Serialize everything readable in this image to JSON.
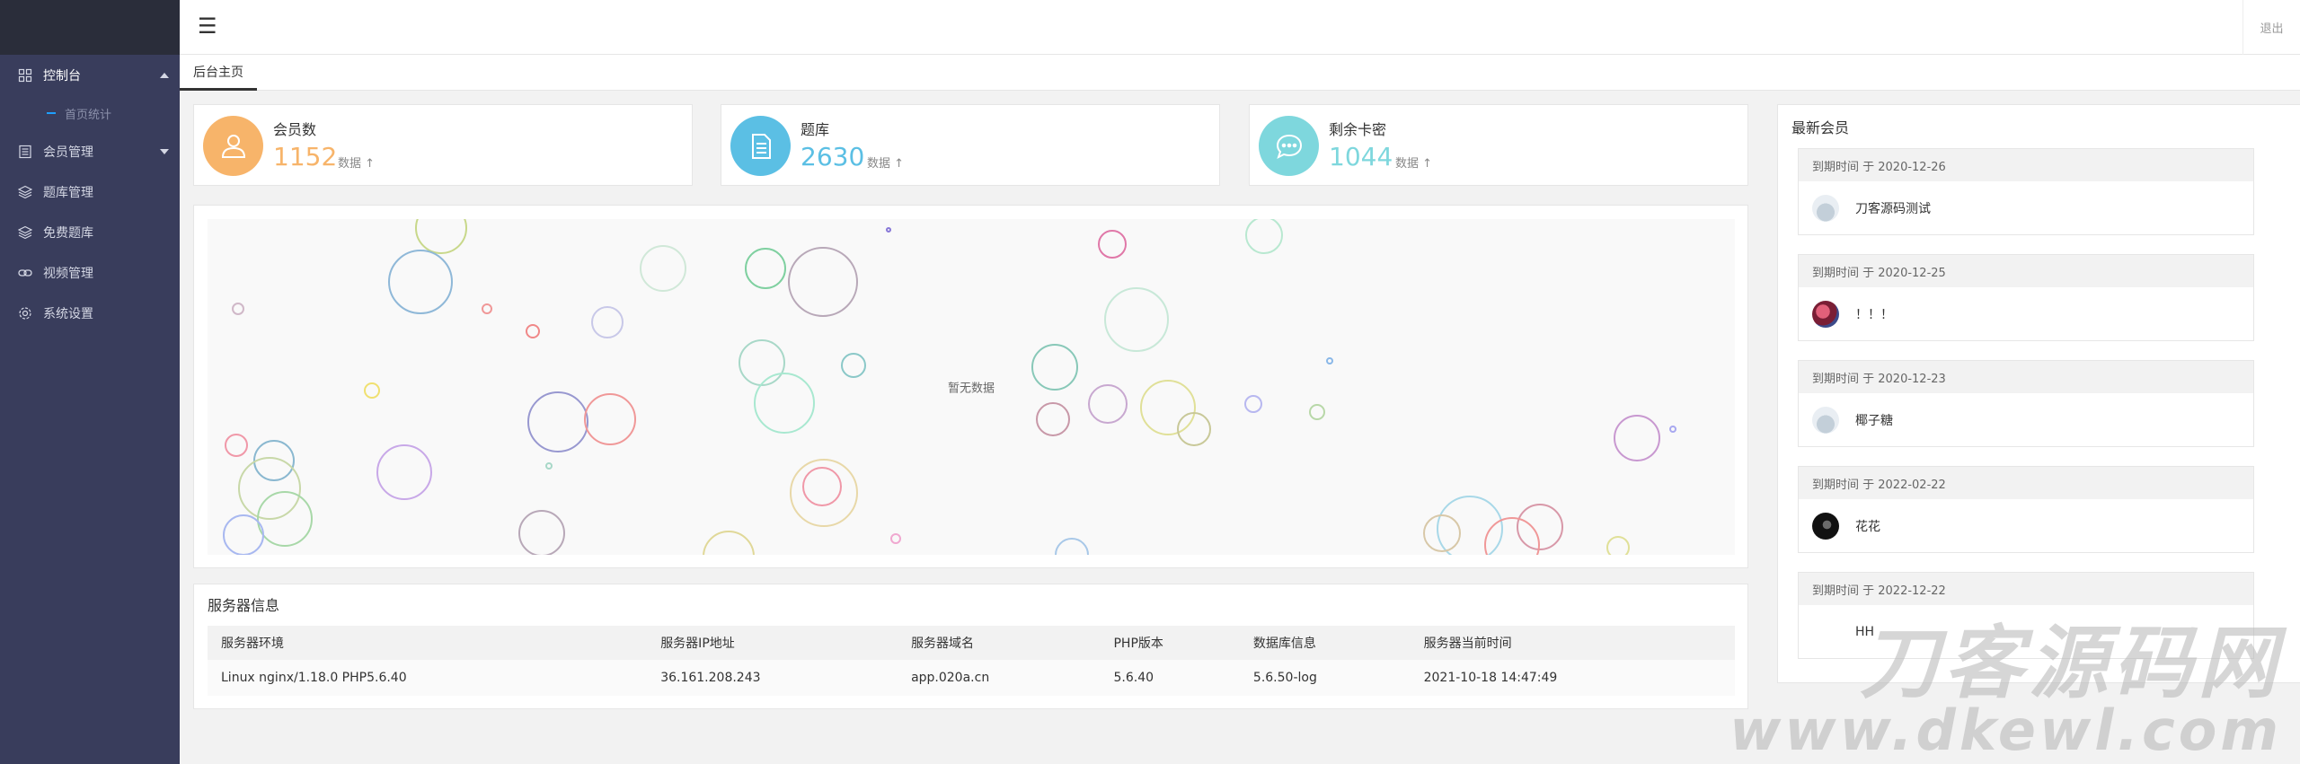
{
  "header": {
    "menu_glyph": "☰",
    "logout_label": "退出"
  },
  "sidebar": {
    "items": [
      {
        "label": "控制台",
        "icon": "grid-icon",
        "expanded": true
      },
      {
        "label": "首页统计",
        "sub": true
      },
      {
        "label": "会员管理",
        "icon": "list-icon",
        "expanded": false
      },
      {
        "label": "题库管理",
        "icon": "layers-icon"
      },
      {
        "label": "免费题库",
        "icon": "layers-icon"
      },
      {
        "label": "视频管理",
        "icon": "link-icon"
      },
      {
        "label": "系统设置",
        "icon": "gear-icon"
      }
    ]
  },
  "tabs": [
    {
      "label": "后台主页",
      "active": true
    }
  ],
  "stats": [
    {
      "label": "会员数",
      "value": "1152",
      "sub": "数据 ↑",
      "color": "#f7b46a",
      "icon": "user-icon"
    },
    {
      "label": "题库",
      "value": "2630",
      "sub": "数据 ↑",
      "color": "#5bbfe4",
      "icon": "document-icon"
    },
    {
      "label": "剩余卡密",
      "value": "1044",
      "sub": "数据 ↑",
      "color": "#7ed7dd",
      "icon": "chat-icon"
    }
  ],
  "chart": {
    "empty_text": "暂无数据"
  },
  "server": {
    "title": "服务器信息",
    "headers": [
      "服务器环境",
      "服务器IP地址",
      "服务器域名",
      "PHP版本",
      "数据库信息",
      "服务器当前时间"
    ],
    "row": [
      "Linux nginx/1.18.0 PHP5.6.40",
      "36.161.208.243",
      "app.020a.cn",
      "5.6.40",
      "5.6.50-log",
      "2021-10-18 14:47:49"
    ]
  },
  "members": {
    "title": "最新会员",
    "items": [
      {
        "date": "到期时间 于 2020-12-26",
        "name": "刀客源码测试",
        "avatar_color": "#dfe7ee"
      },
      {
        "date": "到期时间 于 2020-12-25",
        "name": "！！！",
        "avatar_color": "#b8344a"
      },
      {
        "date": "到期时间 于 2020-12-23",
        "name": "椰子糖",
        "avatar_color": "#dfe7ee"
      },
      {
        "date": "到期时间 于 2022-02-22",
        "name": "花花",
        "avatar_color": "#222222"
      },
      {
        "date": "到期时间 于 2022-12-22",
        "name": "HH",
        "avatar_color": ""
      }
    ]
  },
  "watermark": {
    "line1": "刀客源码网",
    "line2": "www.dkewl.com"
  }
}
